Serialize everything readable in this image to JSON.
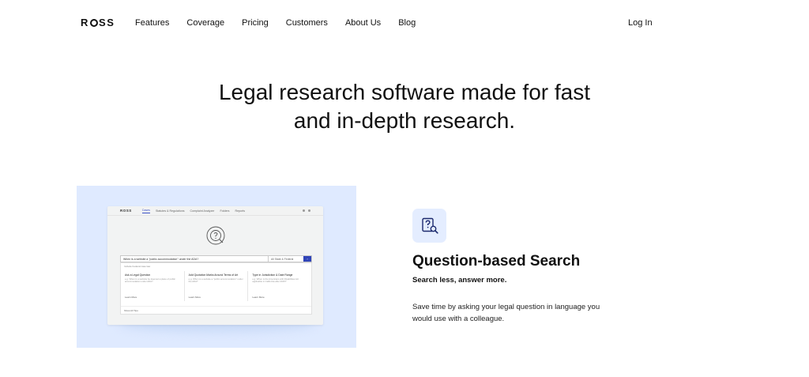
{
  "nav": {
    "logo": "ROSS",
    "links": [
      "Features",
      "Coverage",
      "Pricing",
      "Customers",
      "About Us",
      "Blog"
    ],
    "login": "Log In"
  },
  "hero": {
    "line1": "Legal research software made for fast",
    "line2": "and in-depth research."
  },
  "mockup": {
    "logo": "ROSS",
    "tabs": [
      "Cases",
      "Statutes & Regulations",
      "Complaint Analyzer",
      "Folders",
      "Reports"
    ],
    "query": "When is a website a \"public accommodation\" under the ADA?",
    "jurisdiction": "All State & Federal",
    "go": "›",
    "hint": "Include Federal case law",
    "cards": [
      {
        "title": "Ask a Legal Question",
        "body": "e.g. When is a website be deemed a place of public accommodation under ADA?",
        "link": "Learn More"
      },
      {
        "title": "Add Quotation Marks Around Terms of Art",
        "body": "e.g. When is a website a \"public accommodation\" under the ADA?",
        "link": "Learn More"
      },
      {
        "title": "Type in Jurisdiction & Date Range",
        "body": "e.g. When is the Americans with Disabilities Act applicable in California after 2015?",
        "link": "Learn More"
      }
    ],
    "footer": "Show All Tips"
  },
  "feature": {
    "icon": "question-search-icon",
    "title": "Question-based Search",
    "subtitle": "Search less, answer more.",
    "description": "Save time by asking your legal question in language you would use with a colleague."
  },
  "colors": {
    "accent": "#3044b8",
    "mockup_bg": "#dfeaff",
    "icon_bg": "#e4edff"
  }
}
